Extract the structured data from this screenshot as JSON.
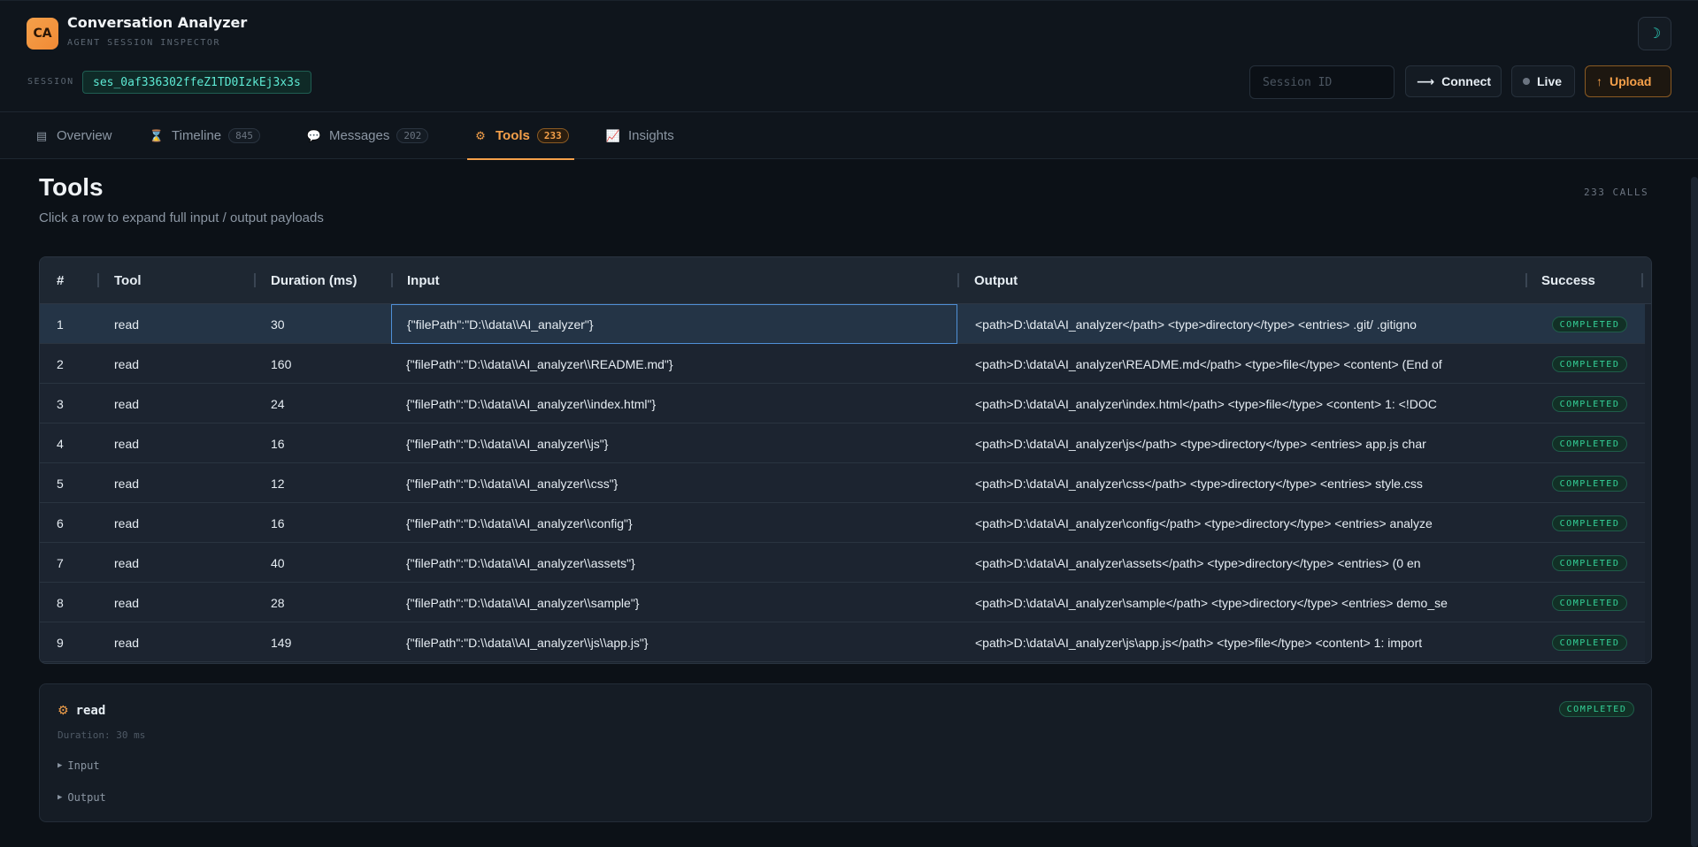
{
  "app": {
    "logo": "CA",
    "title": "Conversation Analyzer",
    "subtitle": "AGENT SESSION INSPECTOR",
    "theme_icon": "moon-icon"
  },
  "session": {
    "label": "SESSION",
    "id": "ses_0af336302ffeZ1TD0IzkEj3x3s",
    "input_placeholder": "Session ID"
  },
  "header_buttons": {
    "connect": "Connect",
    "live": "Live",
    "upload": "Upload"
  },
  "tabs": [
    {
      "label": "Overview",
      "icon": "overview-icon",
      "count": ""
    },
    {
      "label": "Timeline",
      "icon": "hourglass-icon",
      "count": "845"
    },
    {
      "label": "Messages",
      "icon": "speech-bubble-icon",
      "count": "202"
    },
    {
      "label": "Tools",
      "icon": "gear-icon",
      "count": "233"
    },
    {
      "label": "Insights",
      "icon": "chart-icon",
      "count": ""
    }
  ],
  "active_tab": "Tools",
  "page": {
    "title": "Tools",
    "subtitle": "Click a row to expand full input / output payloads",
    "calls": "233 CALLS"
  },
  "table": {
    "headers": [
      "#",
      "Tool",
      "Duration (ms)",
      "Input",
      "Output",
      "Success"
    ],
    "rows": [
      {
        "n": "1",
        "tool": "read",
        "duration": "30",
        "input": "{\"filePath\":\"D:\\\\data\\\\AI_analyzer\"}",
        "output": "<path>D:\\data\\AI_analyzer</path> <type>directory</type> <entries> .git/ .gitigno",
        "status": "COMPLETED"
      },
      {
        "n": "2",
        "tool": "read",
        "duration": "160",
        "input": "{\"filePath\":\"D:\\\\data\\\\AI_analyzer\\\\README.md\"}",
        "output": "<path>D:\\data\\AI_analyzer\\README.md</path> <type>file</type> <content> (End of",
        "status": "COMPLETED"
      },
      {
        "n": "3",
        "tool": "read",
        "duration": "24",
        "input": "{\"filePath\":\"D:\\\\data\\\\AI_analyzer\\\\index.html\"}",
        "output": "<path>D:\\data\\AI_analyzer\\index.html</path> <type>file</type> <content> 1: <!DOC",
        "status": "COMPLETED"
      },
      {
        "n": "4",
        "tool": "read",
        "duration": "16",
        "input": "{\"filePath\":\"D:\\\\data\\\\AI_analyzer\\\\js\"}",
        "output": "<path>D:\\data\\AI_analyzer\\js</path> <type>directory</type> <entries> app.js char",
        "status": "COMPLETED"
      },
      {
        "n": "5",
        "tool": "read",
        "duration": "12",
        "input": "{\"filePath\":\"D:\\\\data\\\\AI_analyzer\\\\css\"}",
        "output": "<path>D:\\data\\AI_analyzer\\css</path> <type>directory</type> <entries> style.css",
        "status": "COMPLETED"
      },
      {
        "n": "6",
        "tool": "read",
        "duration": "16",
        "input": "{\"filePath\":\"D:\\\\data\\\\AI_analyzer\\\\config\"}",
        "output": "<path>D:\\data\\AI_analyzer\\config</path> <type>directory</type> <entries> analyze",
        "status": "COMPLETED"
      },
      {
        "n": "7",
        "tool": "read",
        "duration": "40",
        "input": "{\"filePath\":\"D:\\\\data\\\\AI_analyzer\\\\assets\"}",
        "output": "<path>D:\\data\\AI_analyzer\\assets</path> <type>directory</type> <entries> (0 en",
        "status": "COMPLETED"
      },
      {
        "n": "8",
        "tool": "read",
        "duration": "28",
        "input": "{\"filePath\":\"D:\\\\data\\\\AI_analyzer\\\\sample\"}",
        "output": "<path>D:\\data\\AI_analyzer\\sample</path> <type>directory</type> <entries> demo_se",
        "status": "COMPLETED"
      },
      {
        "n": "9",
        "tool": "read",
        "duration": "149",
        "input": "{\"filePath\":\"D:\\\\data\\\\AI_analyzer\\\\js\\\\app.js\"}",
        "output": "<path>D:\\data\\AI_analyzer\\js\\app.js</path> <type>file</type> <content> 1: import",
        "status": "COMPLETED"
      }
    ]
  },
  "detail": {
    "tool": "read",
    "duration": "Duration: 30 ms",
    "status": "COMPLETED",
    "input_label": "Input",
    "output_label": "Output"
  },
  "colors": {
    "accent": "#f5a04a",
    "teal": "#5eead4",
    "success": "#34d399",
    "background": "#0c1117"
  }
}
